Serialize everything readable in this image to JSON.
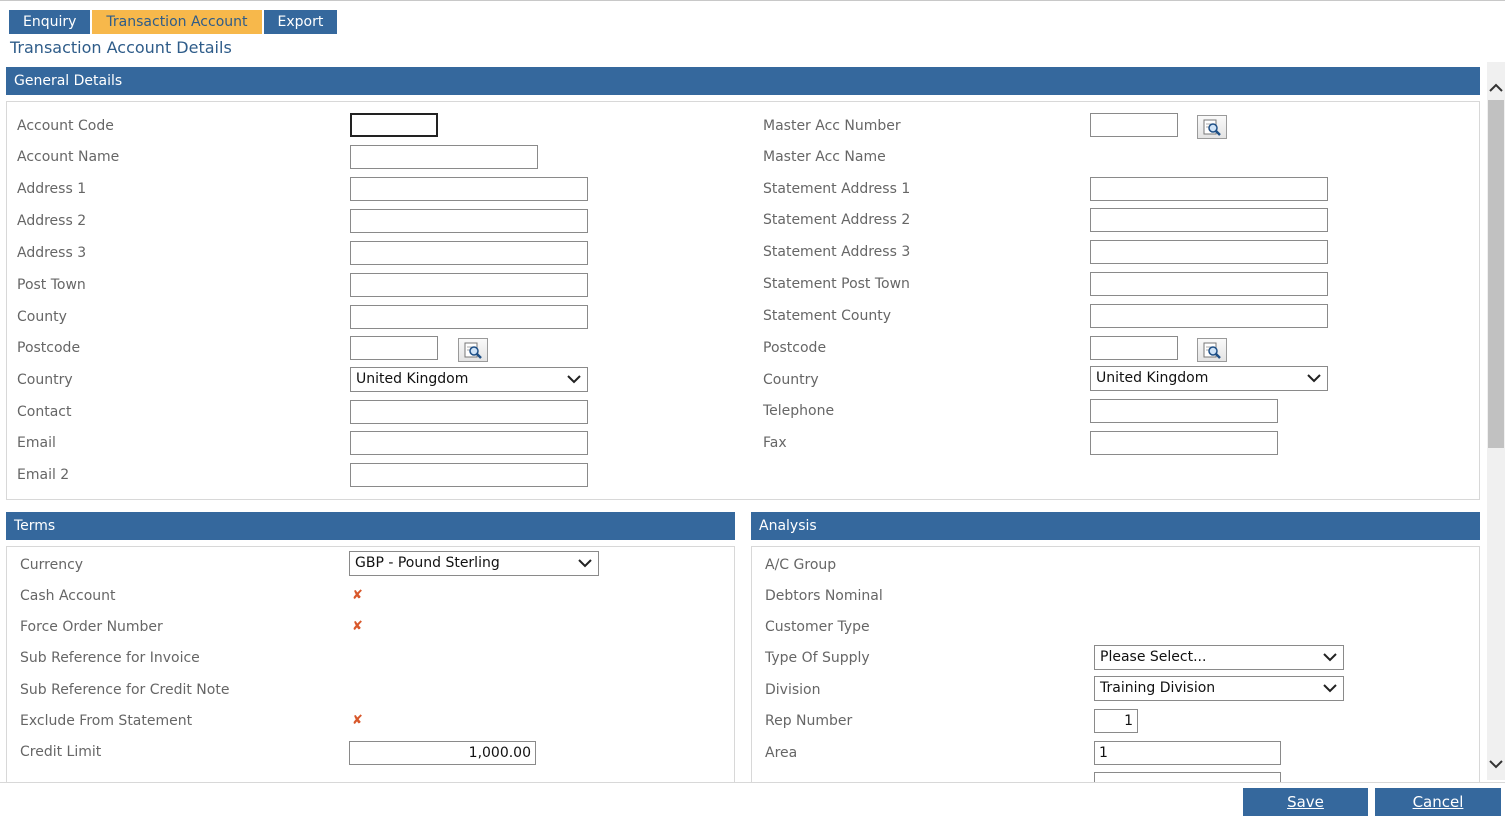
{
  "tabs": [
    {
      "label": "Enquiry",
      "active": false
    },
    {
      "label": "Transaction Account",
      "active": true
    },
    {
      "label": "Export",
      "active": false
    }
  ],
  "page_title": "Transaction Account Details",
  "general": {
    "header": "General Details",
    "left": {
      "account_code": {
        "label": "Account Code",
        "value": ""
      },
      "account_name": {
        "label": "Account Name",
        "value": ""
      },
      "address1": {
        "label": "Address 1",
        "value": ""
      },
      "address2": {
        "label": "Address 2",
        "value": ""
      },
      "address3": {
        "label": "Address 3",
        "value": ""
      },
      "post_town": {
        "label": "Post Town",
        "value": ""
      },
      "county": {
        "label": "County",
        "value": ""
      },
      "postcode": {
        "label": "Postcode",
        "value": ""
      },
      "country": {
        "label": "Country",
        "value": "United Kingdom"
      },
      "contact": {
        "label": "Contact",
        "value": ""
      },
      "email": {
        "label": "Email",
        "value": ""
      },
      "email2": {
        "label": "Email 2",
        "value": ""
      }
    },
    "right": {
      "master_acc_number": {
        "label": "Master Acc Number",
        "value": ""
      },
      "master_acc_name": {
        "label": "Master Acc Name"
      },
      "stmt_address1": {
        "label": "Statement Address 1",
        "value": ""
      },
      "stmt_address2": {
        "label": "Statement Address 2",
        "value": ""
      },
      "stmt_address3": {
        "label": "Statement Address 3",
        "value": ""
      },
      "stmt_post_town": {
        "label": "Statement Post Town",
        "value": ""
      },
      "stmt_county": {
        "label": "Statement County",
        "value": ""
      },
      "postcode": {
        "label": "Postcode",
        "value": ""
      },
      "country": {
        "label": "Country",
        "value": "United Kingdom"
      },
      "telephone": {
        "label": "Telephone",
        "value": ""
      },
      "fax": {
        "label": "Fax",
        "value": ""
      }
    }
  },
  "terms": {
    "header": "Terms",
    "currency": {
      "label": "Currency",
      "value": "GBP - Pound Sterling"
    },
    "cash_account": {
      "label": "Cash Account",
      "checked": false
    },
    "force_order_number": {
      "label": "Force Order Number",
      "checked": false
    },
    "sub_ref_invoice": {
      "label": "Sub Reference for Invoice"
    },
    "sub_ref_credit": {
      "label": "Sub Reference for Credit Note"
    },
    "exclude_from_statement": {
      "label": "Exclude From Statement",
      "checked": false
    },
    "credit_limit": {
      "label": "Credit Limit",
      "value": "1,000.00"
    }
  },
  "analysis": {
    "header": "Analysis",
    "ac_group": {
      "label": "A/C Group"
    },
    "debtors_nominal": {
      "label": "Debtors Nominal"
    },
    "customer_type": {
      "label": "Customer Type"
    },
    "type_of_supply": {
      "label": "Type Of Supply",
      "value": "Please Select..."
    },
    "division": {
      "label": "Division",
      "value": "Training Division"
    },
    "rep_number": {
      "label": "Rep Number",
      "value": "1"
    },
    "area": {
      "label": "Area",
      "value": "1"
    }
  },
  "footer": {
    "save": "Save",
    "cancel": "Cancel"
  },
  "colors": {
    "header_blue": "#35689d",
    "active_tab": "#f7b84b",
    "cross": "#d8582b"
  },
  "icons": [
    "lookup-icon",
    "chevron-down-icon",
    "cross-icon",
    "scroll-up-icon",
    "scroll-down-icon"
  ]
}
